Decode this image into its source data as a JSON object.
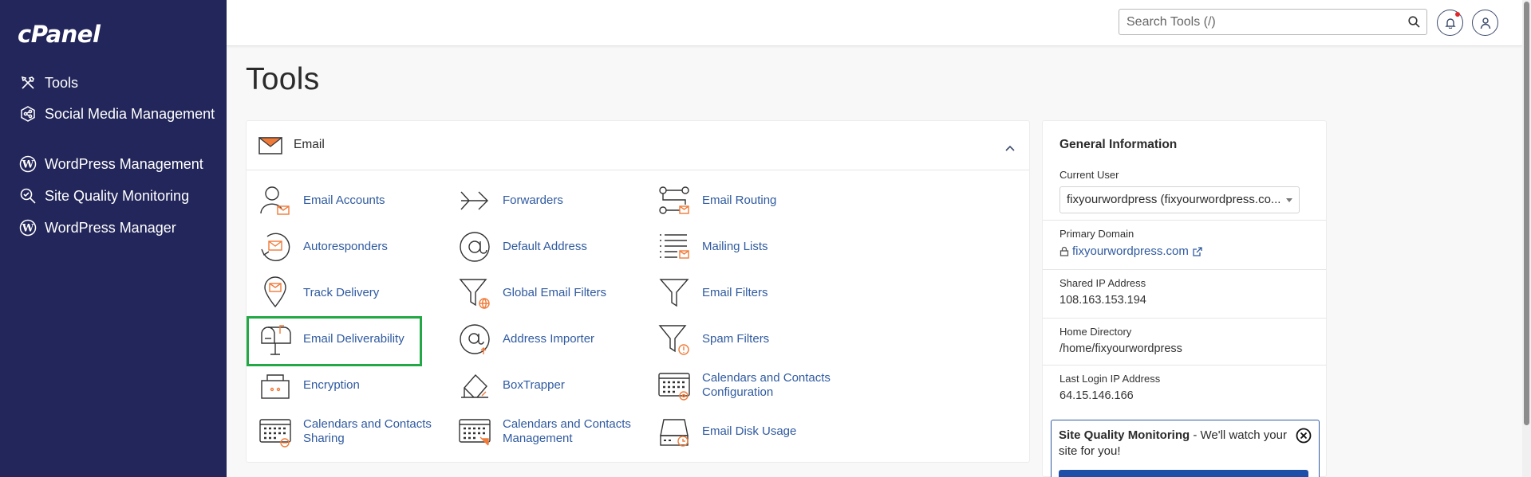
{
  "brand": {
    "logo": "cPanel"
  },
  "sidebar": {
    "items": [
      {
        "label": "Tools",
        "icon": "tools-icon"
      },
      {
        "label": "Social Media Management",
        "icon": "social-media-icon"
      },
      {
        "label": "WordPress Management",
        "icon": "wordpress-icon"
      },
      {
        "label": "Site Quality Monitoring",
        "icon": "magnifier-check-icon"
      },
      {
        "label": "WordPress Manager",
        "icon": "wordpress-icon"
      }
    ]
  },
  "header": {
    "search_placeholder": "Search Tools (/)",
    "notification_dot_color": "#e0292f"
  },
  "page": {
    "title": "Tools"
  },
  "email_panel": {
    "title": "Email",
    "tools": [
      {
        "label": "Email Accounts",
        "icon": "email-accounts-icon"
      },
      {
        "label": "Forwarders",
        "icon": "forwarders-icon"
      },
      {
        "label": "Email Routing",
        "icon": "email-routing-icon"
      },
      {
        "label": "Autoresponders",
        "icon": "autoresponders-icon"
      },
      {
        "label": "Default Address",
        "icon": "default-address-icon"
      },
      {
        "label": "Mailing Lists",
        "icon": "mailing-lists-icon"
      },
      {
        "label": "Track Delivery",
        "icon": "track-delivery-icon"
      },
      {
        "label": "Global Email Filters",
        "icon": "global-email-filters-icon"
      },
      {
        "label": "Email Filters",
        "icon": "email-filters-icon"
      },
      {
        "label": "Email Deliverability",
        "icon": "email-deliverability-icon",
        "highlighted": true
      },
      {
        "label": "Address Importer",
        "icon": "address-importer-icon"
      },
      {
        "label": "Spam Filters",
        "icon": "spam-filters-icon"
      },
      {
        "label": "Encryption",
        "icon": "encryption-icon"
      },
      {
        "label": "BoxTrapper",
        "icon": "boxtrapper-icon"
      },
      {
        "label": "Calendars and Contacts Configuration",
        "icon": "calendar-config-icon"
      },
      {
        "label": "Calendars and Contacts Sharing",
        "icon": "calendar-sharing-icon"
      },
      {
        "label": "Calendars and Contacts Management",
        "icon": "calendar-management-icon"
      },
      {
        "label": "Email Disk Usage",
        "icon": "email-disk-usage-icon"
      }
    ]
  },
  "general_info": {
    "title": "General Information",
    "current_user_label": "Current User",
    "current_user_value": "fixyourwordpress (fixyourwordpress.co...",
    "primary_domain_label": "Primary Domain",
    "primary_domain_value": "fixyourwordpress.com",
    "shared_ip_label": "Shared IP Address",
    "shared_ip_value": "108.163.153.194",
    "home_dir_label": "Home Directory",
    "home_dir_value": "/home/fixyourwordpress",
    "last_login_label": "Last Login IP Address",
    "last_login_value": "64.15.146.166"
  },
  "sqm_banner": {
    "title": "Site Quality Monitoring",
    "text": " - We'll watch your site for you!"
  },
  "colors": {
    "sidebar": "#23265a",
    "link": "#2f5aa0",
    "accent_orange": "#f07b39",
    "highlight": "#22a845"
  }
}
